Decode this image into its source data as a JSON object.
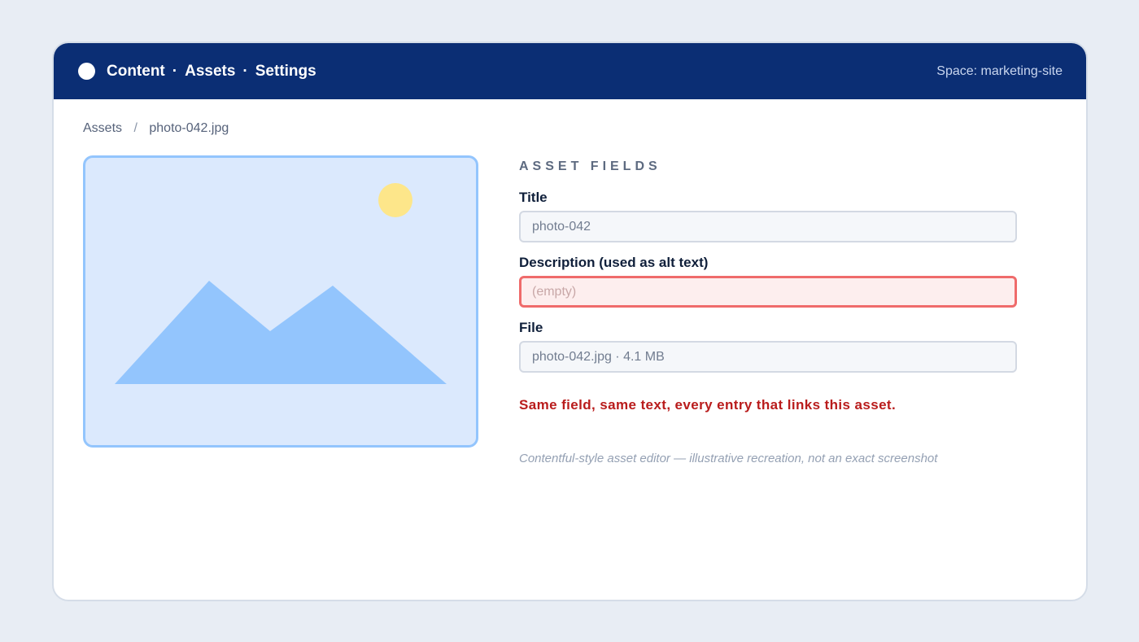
{
  "topbar": {
    "nav": [
      "Content",
      "Assets",
      "Settings"
    ],
    "nav_separator": "·",
    "space": "Space: marketing-site"
  },
  "breadcrumb": {
    "items": [
      "Assets",
      "photo-042.jpg"
    ],
    "separator": "/"
  },
  "preview": {
    "icon": "image-placeholder-icon",
    "colors": {
      "background": "#dbe9fd",
      "border": "#93c5fd",
      "mountains": "#93c5fd",
      "sun": "#fde68a"
    }
  },
  "fields": {
    "heading": "ASSET FIELDS",
    "title": {
      "label": "Title",
      "value": "photo-042"
    },
    "description": {
      "label": "Description (used as alt text)",
      "placeholder": "(empty)",
      "state": "error"
    },
    "file": {
      "label": "File",
      "value": "photo-042.jpg · 4.1 MB"
    }
  },
  "warning": "Same field, same text, every entry that links this asset.",
  "caption": "Contentful-style asset editor — illustrative recreation, not an exact screenshot",
  "colors": {
    "topbar": "#0b2e74",
    "error": "#ef6b6b",
    "warning_text": "#b91c1c"
  }
}
